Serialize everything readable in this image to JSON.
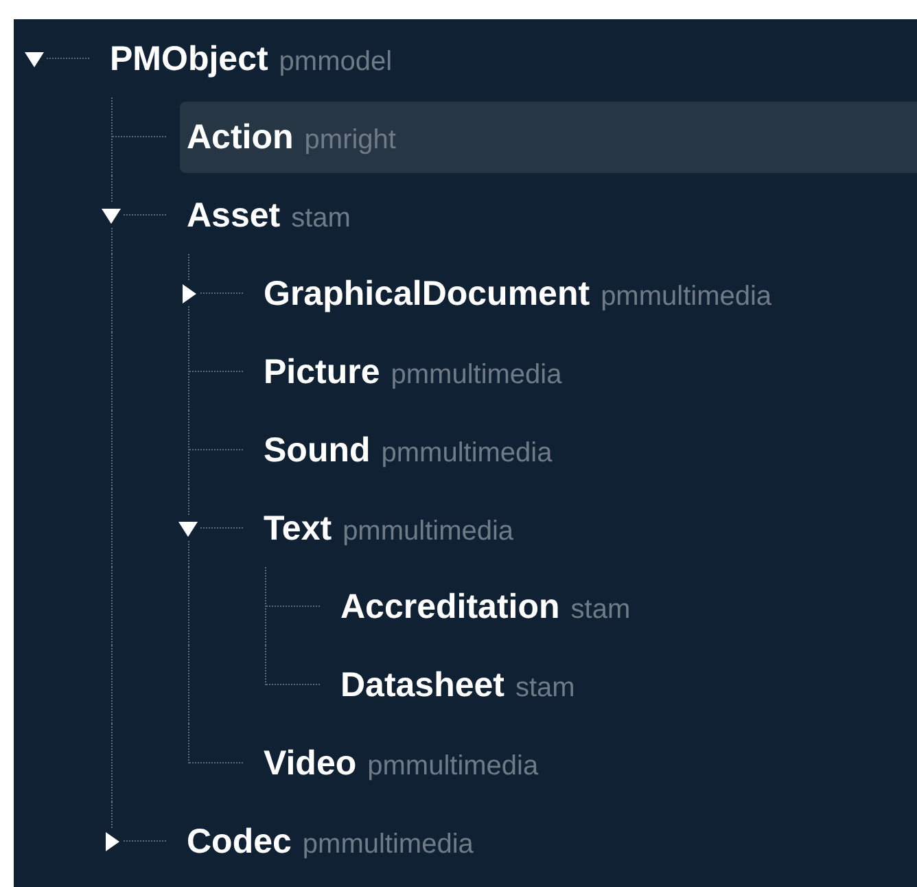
{
  "tree": [
    {
      "name": "PMObject",
      "module": "pmmodel",
      "expanded": true,
      "selected": false,
      "children": [
        {
          "name": "Action",
          "module": "pmright",
          "selected": true
        },
        {
          "name": "Asset",
          "module": "stam",
          "expanded": true,
          "selected": false,
          "children": [
            {
              "name": "GraphicalDocument",
              "module": "pmmultimedia",
              "expanded": false,
              "selected": false
            },
            {
              "name": "Picture",
              "module": "pmmultimedia",
              "selected": false
            },
            {
              "name": "Sound",
              "module": "pmmultimedia",
              "selected": false
            },
            {
              "name": "Text",
              "module": "pmmultimedia",
              "expanded": true,
              "selected": false,
              "children": [
                {
                  "name": "Accreditation",
                  "module": "stam",
                  "selected": false
                },
                {
                  "name": "Datasheet",
                  "module": "stam",
                  "selected": false
                }
              ]
            },
            {
              "name": "Video",
              "module": "pmmultimedia",
              "selected": false
            }
          ]
        },
        {
          "name": "Codec",
          "module": "pmmultimedia",
          "expanded": false,
          "selected": false
        }
      ]
    }
  ]
}
